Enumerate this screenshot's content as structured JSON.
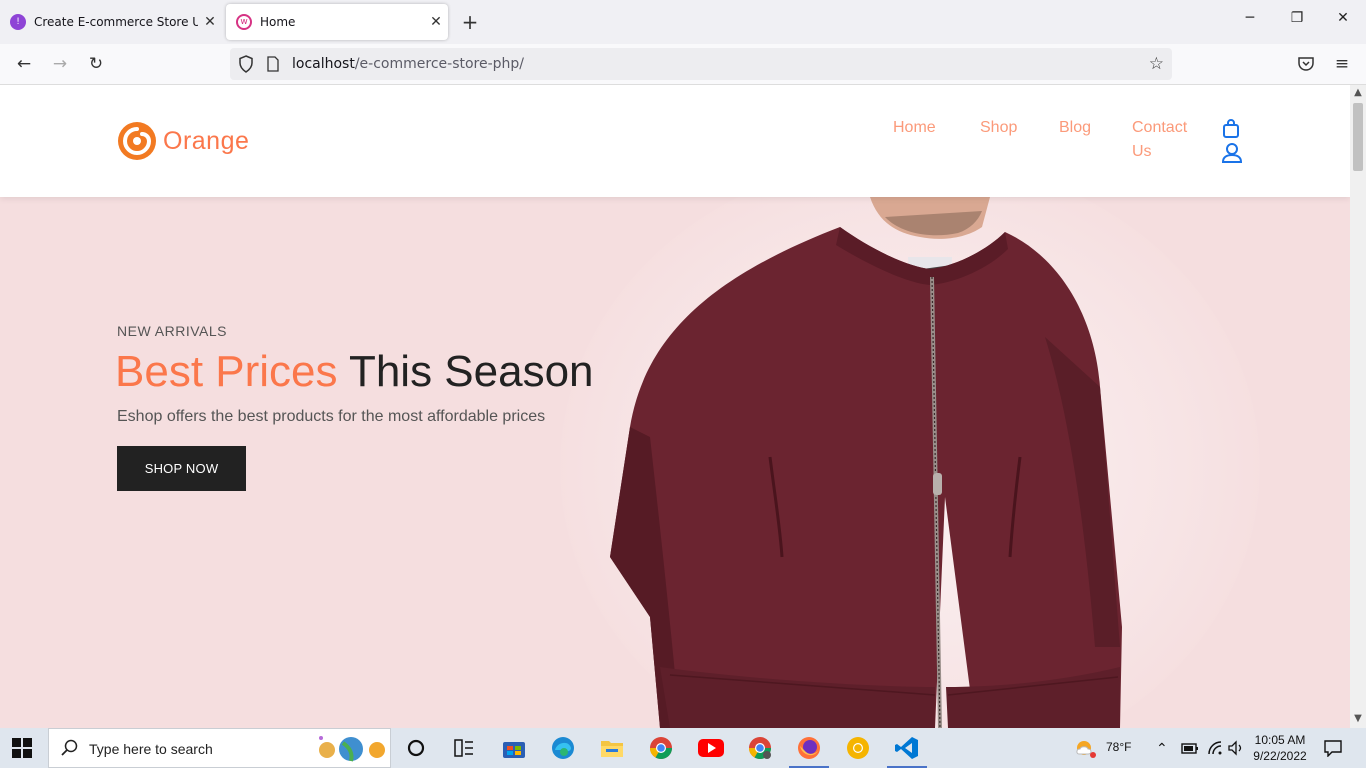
{
  "browser": {
    "tabs": [
      {
        "title": "Create E-commerce Store Using",
        "active": false
      },
      {
        "title": "Home",
        "active": true
      }
    ],
    "url_host": "localhost",
    "url_path": "/e-commerce-store-php/"
  },
  "site": {
    "brand": "Orange",
    "nav": {
      "home": "Home",
      "shop": "Shop",
      "blog": "Blog",
      "contact_line1": "Contact",
      "contact_line2": "Us"
    },
    "hero": {
      "kicker": "NEW ARRIVALS",
      "headline_accent": "Best Prices",
      "headline_rest": " This Season",
      "subtitle": "Eshop offers the best products for the most affordable prices",
      "cta": "SHOP NOW"
    }
  },
  "taskbar": {
    "search_placeholder": "Type here to search",
    "weather": "78°F",
    "time": "10:05 AM",
    "date": "9/22/2022"
  },
  "colors": {
    "accent": "#fb774b",
    "hero_bg": "#f5dedf",
    "nav_link": "#fb9a7a",
    "icon_blue": "#1a73e8",
    "jacket": "#6b2430"
  }
}
